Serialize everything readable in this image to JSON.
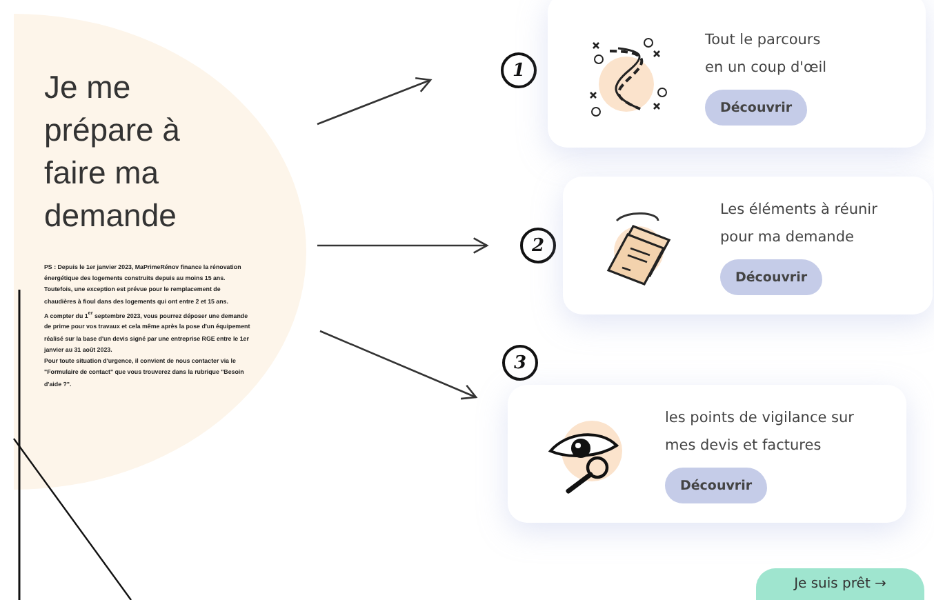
{
  "intro": {
    "heading": "Je me prépare à faire ma demande",
    "paragraphs": [
      "PS : Depuis le 1er janvier 2023, MaPrimeRénov finance la rénovation énergétique des logements construits depuis au moins 15 ans. Toutefois, une exception est prévue pour le remplacement de chaudières à fioul dans des logements qui ont entre 2 et 15 ans.",
      "A compter du 1$^{er}$ septembre 2023, vous pourrez déposer une demande de prime pour vos travaux et cela même après la pose d'un équipement réalisé sur la base d'un devis signé par une entreprise RGE entre le 1er janvier au 31 août 2023.",
      "Pour toute situation d'urgence, il convient de nous contacter via le \"Formulaire de contact\" que vous trouverez dans la rubrique \"Besoin d'aide ?\"."
    ]
  },
  "steps": [
    {
      "number": "1",
      "kind": "route",
      "lines": [
        "Tout le parcours",
        "en un coup d'œil"
      ],
      "button": "Découvrir"
    },
    {
      "number": "2",
      "kind": "documents",
      "lines": [
        "Les éléments à réunir",
        "pour ma demande"
      ],
      "button": "Découvrir"
    },
    {
      "number": "3",
      "kind": "vigilance",
      "lines": [
        "les points de vigilance sur",
        "mes devis et factures"
      ],
      "button": "Découvrir"
    }
  ],
  "cta": "Je suis prêt →"
}
